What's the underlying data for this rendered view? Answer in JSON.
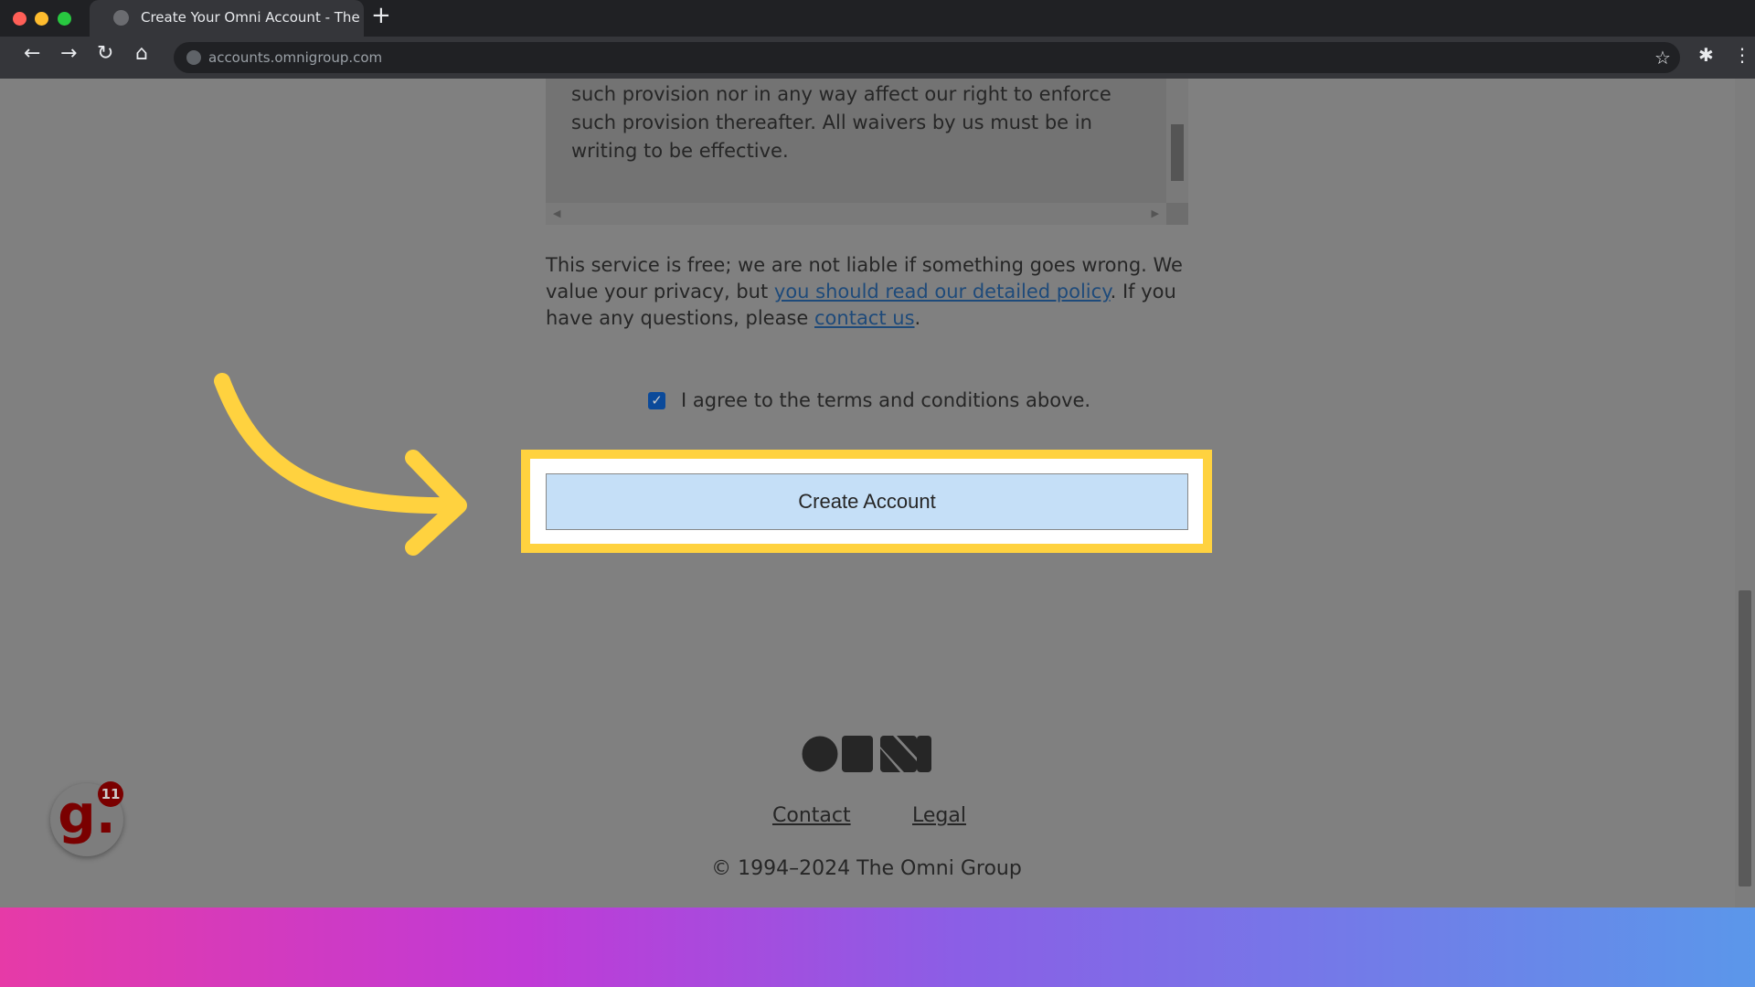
{
  "browser": {
    "tab_title": "Create Your Omni Account - The (",
    "url": "accounts.omnigroup.com"
  },
  "terms_box": {
    "text": "such provision nor in any way affect our right to enforce such provision thereafter. All waivers by us must be in writing to be effective."
  },
  "notice": {
    "before": "This service is free; we are not liable if something goes wrong. We value your privacy, but ",
    "policy_link": "you should read our detailed policy",
    "middle": ". If you have any questions, please ",
    "contact_link": "contact us",
    "after": "."
  },
  "agreement": {
    "label": "I agree to the terms and conditions above.",
    "checked": true
  },
  "create_button": "Create Account",
  "footer": {
    "contact": "Contact",
    "legal": "Legal",
    "copyright": "© 1994–2024 The Omni Group",
    "logo": "OMNI"
  },
  "badge": {
    "letter": "g.",
    "count": "11"
  },
  "colors": {
    "highlight": "#ffd23f",
    "button": "#c5dff7",
    "checkbox": "#0b4a9a"
  }
}
